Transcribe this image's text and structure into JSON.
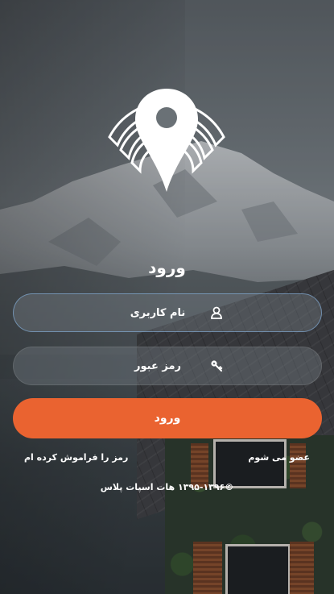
{
  "login": {
    "title": "ورود",
    "username_placeholder": "نام کاربری",
    "password_placeholder": "رمز عبور",
    "submit_label": "ورود",
    "forgot_password_label": "رمز را فراموش کرده ام",
    "signup_label": "عضو می شوم",
    "copyright": "©۱۳۹۵-۱۳۹۶ هات اسپات پلاس"
  },
  "icons": {
    "logo": "location-pin-wifi-logo",
    "username": "user-icon",
    "password": "key-icon"
  },
  "colors": {
    "accent": "#ea6330",
    "text": "#ffffff",
    "field_background": "rgba(120,130,138,0.38)"
  }
}
